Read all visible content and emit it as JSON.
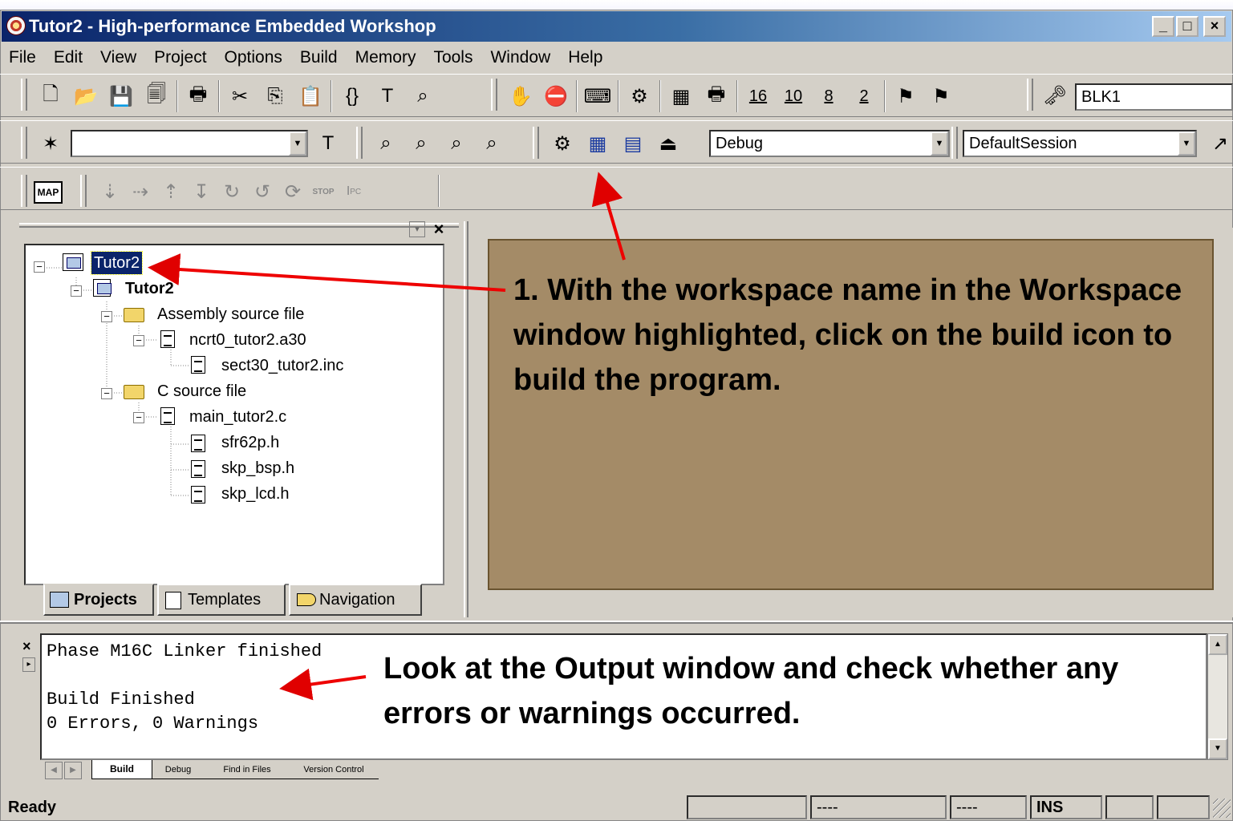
{
  "window": {
    "title": "Tutor2 - High-performance Embedded Workshop",
    "caption_buttons": [
      "_",
      "□",
      "×"
    ]
  },
  "menu": [
    "File",
    "Edit",
    "View",
    "Project",
    "Options",
    "Build",
    "Memory",
    "Tools",
    "Window",
    "Help"
  ],
  "toolbar1": {
    "radix_buttons": [
      "16",
      "10",
      "8",
      "2"
    ],
    "block_label": "BLK1"
  },
  "toolbar2": {
    "config_value": "Debug",
    "session_value": "DefaultSession"
  },
  "toolbar3": {
    "map_label": "MAP",
    "stop_label": "STOP",
    "pc_label": "I",
    "pc_sub": "PC"
  },
  "workspace": {
    "items": [
      {
        "label": "Tutor2",
        "level": 0,
        "icon": "workspace-icon",
        "selected": true
      },
      {
        "label": "Tutor2",
        "level": 1,
        "icon": "project-icon",
        "bold": true
      },
      {
        "label": "Assembly source file",
        "level": 2,
        "icon": "folder-icon"
      },
      {
        "label": "ncrt0_tutor2.a30",
        "level": 3,
        "icon": "source-file-icon"
      },
      {
        "label": "sect30_tutor2.inc",
        "level": 4,
        "icon": "include-file-icon"
      },
      {
        "label": "C source file",
        "level": 2,
        "icon": "folder-icon"
      },
      {
        "label": "main_tutor2.c",
        "level": 3,
        "icon": "source-file-icon"
      },
      {
        "label": "sfr62p.h",
        "level": 4,
        "icon": "header-file-icon"
      },
      {
        "label": "skp_bsp.h",
        "level": 4,
        "icon": "header-file-icon"
      },
      {
        "label": "skp_lcd.h",
        "level": 4,
        "icon": "header-file-icon"
      }
    ],
    "tabs": [
      "Projects",
      "Templates",
      "Navigation"
    ]
  },
  "callout_main": "1. With the workspace name in the Workspace window highlighted, click on the build icon to build the program.",
  "callout_output": "Look at the Output window and check whether any errors or warnings occurred.",
  "output": {
    "lines": [
      "Phase M16C Linker finished",
      "",
      "Build Finished",
      "0 Errors, 0 Warnings"
    ],
    "tabs": [
      "Build",
      "Debug",
      "Find in Files",
      "Version Control"
    ]
  },
  "status": {
    "text": "Ready",
    "cells": [
      "",
      "----",
      "----",
      "INS",
      "",
      ""
    ]
  },
  "colors": {
    "caption_start": "#0a246a",
    "caption_end": "#a6caf0",
    "callout_bg": "#a48b67",
    "arrow": "#e00000",
    "selection": "#0a246a"
  }
}
